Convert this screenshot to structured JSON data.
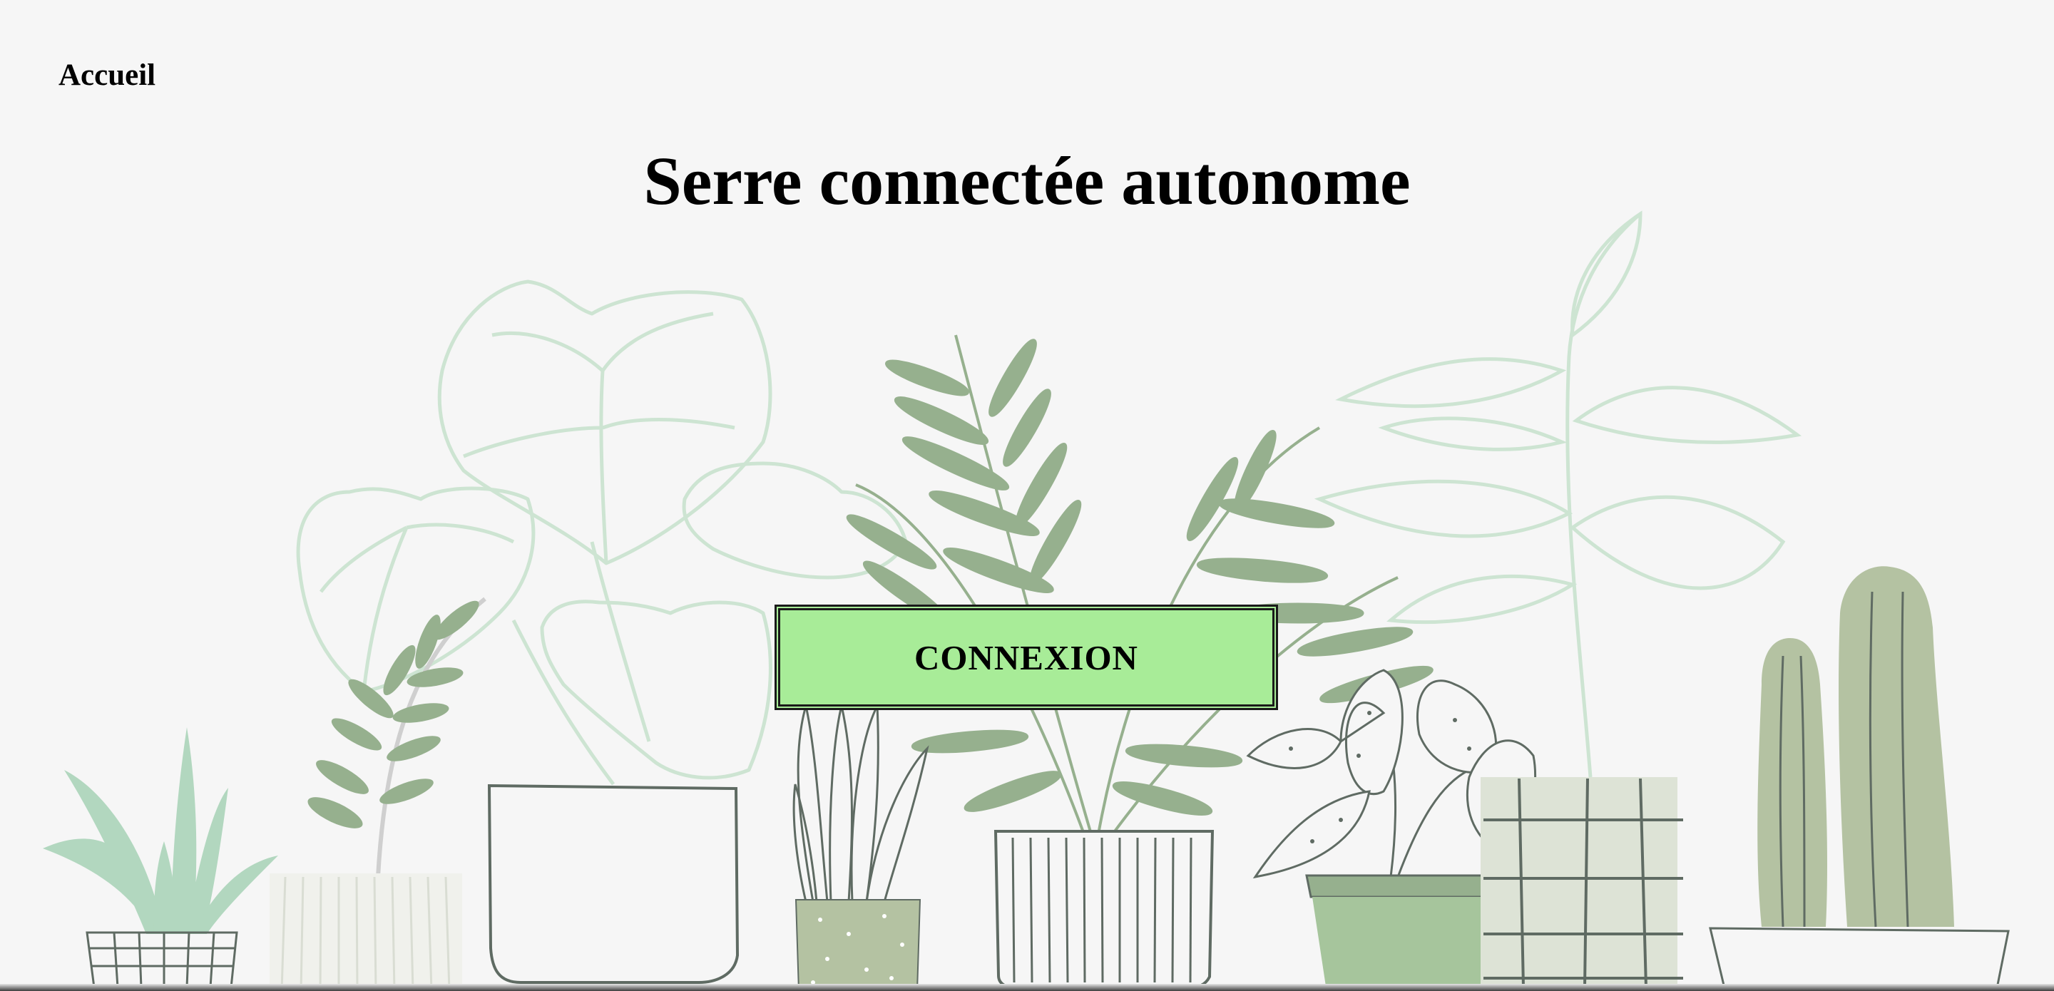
{
  "nav": {
    "home_label": "Accueil"
  },
  "page": {
    "title": "Serre connectée autonome"
  },
  "login": {
    "button_label": "CONNEXION",
    "button_color": "#a8ec98"
  },
  "illustration": {
    "name": "potted-plants-illustration",
    "colors": {
      "pale_leaf": "#cde4d2",
      "sage_leaf": "#96b08e",
      "mint_leaf": "#b2d7bf",
      "olive_leaf": "#b4c2a2",
      "pot_outline": "#5f6b63"
    }
  }
}
